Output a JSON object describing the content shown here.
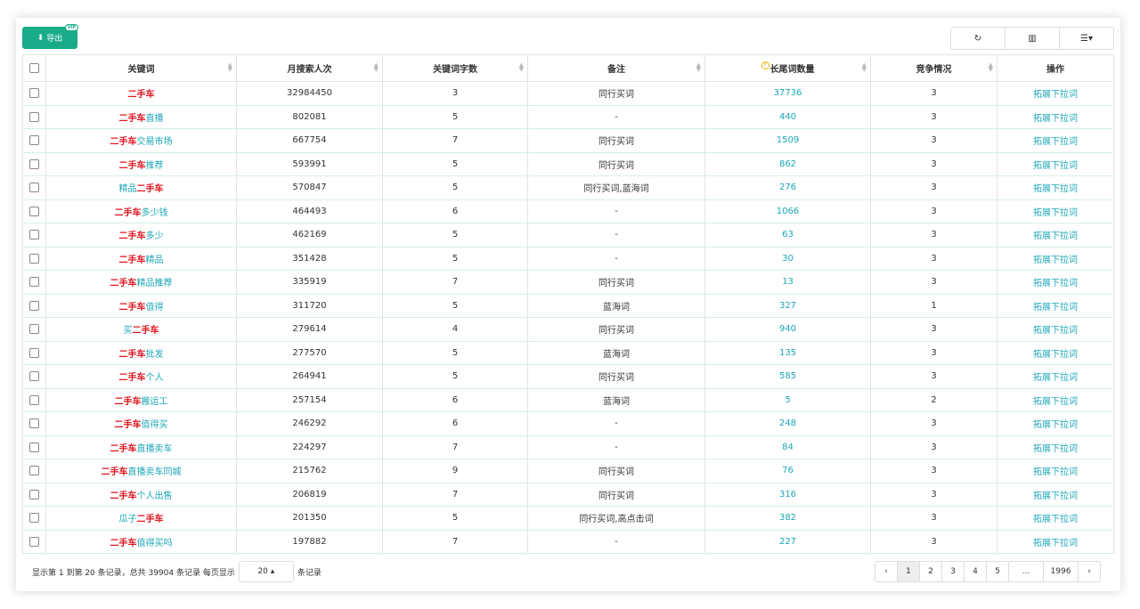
{
  "toolbar": {
    "export_label": "导出",
    "vip_badge": "VIP",
    "refresh_icon": "↻",
    "columns_icon": "▥",
    "menu_icon": "☰▾"
  },
  "table": {
    "headers": {
      "keyword": "关键词",
      "monthly_search": "月搜索人次",
      "char_count": "关键词字数",
      "note": "备注",
      "longtail": "长尾词数量",
      "competition": "竞争情况",
      "action": "操作"
    },
    "action_label": "拓展下拉词",
    "rows": [
      {
        "core": "二手车",
        "pre": "",
        "post": "",
        "search": "32984450",
        "chars": "3",
        "note": "同行买词",
        "longtail": "37736",
        "comp": "3"
      },
      {
        "core": "二手车",
        "pre": "",
        "post": "直播",
        "search": "802081",
        "chars": "5",
        "note": "-",
        "longtail": "440",
        "comp": "3"
      },
      {
        "core": "二手车",
        "pre": "",
        "post": "交易市场",
        "search": "667754",
        "chars": "7",
        "note": "同行买词",
        "longtail": "1509",
        "comp": "3"
      },
      {
        "core": "二手车",
        "pre": "",
        "post": "推荐",
        "search": "593991",
        "chars": "5",
        "note": "同行买词",
        "longtail": "862",
        "comp": "3"
      },
      {
        "core": "二手车",
        "pre": "精品",
        "post": "",
        "search": "570847",
        "chars": "5",
        "note": "同行买词,蓝海词",
        "longtail": "276",
        "comp": "3"
      },
      {
        "core": "二手车",
        "pre": "",
        "post": "多少钱",
        "search": "464493",
        "chars": "6",
        "note": "-",
        "longtail": "1066",
        "comp": "3"
      },
      {
        "core": "二手车",
        "pre": "",
        "post": "多少",
        "search": "462169",
        "chars": "5",
        "note": "-",
        "longtail": "63",
        "comp": "3"
      },
      {
        "core": "二手车",
        "pre": "",
        "post": "精品",
        "search": "351428",
        "chars": "5",
        "note": "-",
        "longtail": "30",
        "comp": "3"
      },
      {
        "core": "二手车",
        "pre": "",
        "post": "精品推荐",
        "search": "335919",
        "chars": "7",
        "note": "同行买词",
        "longtail": "13",
        "comp": "3"
      },
      {
        "core": "二手车",
        "pre": "",
        "post": "值得",
        "search": "311720",
        "chars": "5",
        "note": "蓝海词",
        "longtail": "327",
        "comp": "1"
      },
      {
        "core": "二手车",
        "pre": "买",
        "post": "",
        "search": "279614",
        "chars": "4",
        "note": "同行买词",
        "longtail": "940",
        "comp": "3"
      },
      {
        "core": "二手车",
        "pre": "",
        "post": "批发",
        "search": "277570",
        "chars": "5",
        "note": "蓝海词",
        "longtail": "135",
        "comp": "3"
      },
      {
        "core": "二手车",
        "pre": "",
        "post": "个人",
        "search": "264941",
        "chars": "5",
        "note": "同行买词",
        "longtail": "585",
        "comp": "3"
      },
      {
        "core": "二手车",
        "pre": "",
        "post": "搬运工",
        "search": "257154",
        "chars": "6",
        "note": "蓝海词",
        "longtail": "5",
        "comp": "2"
      },
      {
        "core": "二手车",
        "pre": "",
        "post": "值得买",
        "search": "246292",
        "chars": "6",
        "note": "-",
        "longtail": "248",
        "comp": "3"
      },
      {
        "core": "二手车",
        "pre": "",
        "post": "直播卖车",
        "search": "224297",
        "chars": "7",
        "note": "-",
        "longtail": "84",
        "comp": "3"
      },
      {
        "core": "二手车",
        "pre": "",
        "post": "直播卖车同城",
        "search": "215762",
        "chars": "9",
        "note": "同行买词",
        "longtail": "76",
        "comp": "3"
      },
      {
        "core": "二手车",
        "pre": "",
        "post": "个人出售",
        "search": "206819",
        "chars": "7",
        "note": "同行买词",
        "longtail": "316",
        "comp": "3"
      },
      {
        "core": "二手车",
        "pre": "瓜子",
        "post": "",
        "search": "201350",
        "chars": "5",
        "note": "同行买词,高点击词",
        "longtail": "382",
        "comp": "3"
      },
      {
        "core": "二手车",
        "pre": "",
        "post": "值得买吗",
        "search": "197882",
        "chars": "7",
        "note": "-",
        "longtail": "227",
        "comp": "3"
      }
    ]
  },
  "footer": {
    "info_prefix": "显示第 1 到第 20 条记录，总共 39904 条记录 每页显示",
    "page_size": "20 ▴",
    "info_suffix": "条记录",
    "pages": [
      "‹",
      "1",
      "2",
      "3",
      "4",
      "5",
      "...",
      "1996",
      "›"
    ],
    "active_page": "1"
  },
  "colors": {
    "accent": "#1aab8a",
    "keyword_core": "#e0141e",
    "link": "#1aa6b7"
  }
}
